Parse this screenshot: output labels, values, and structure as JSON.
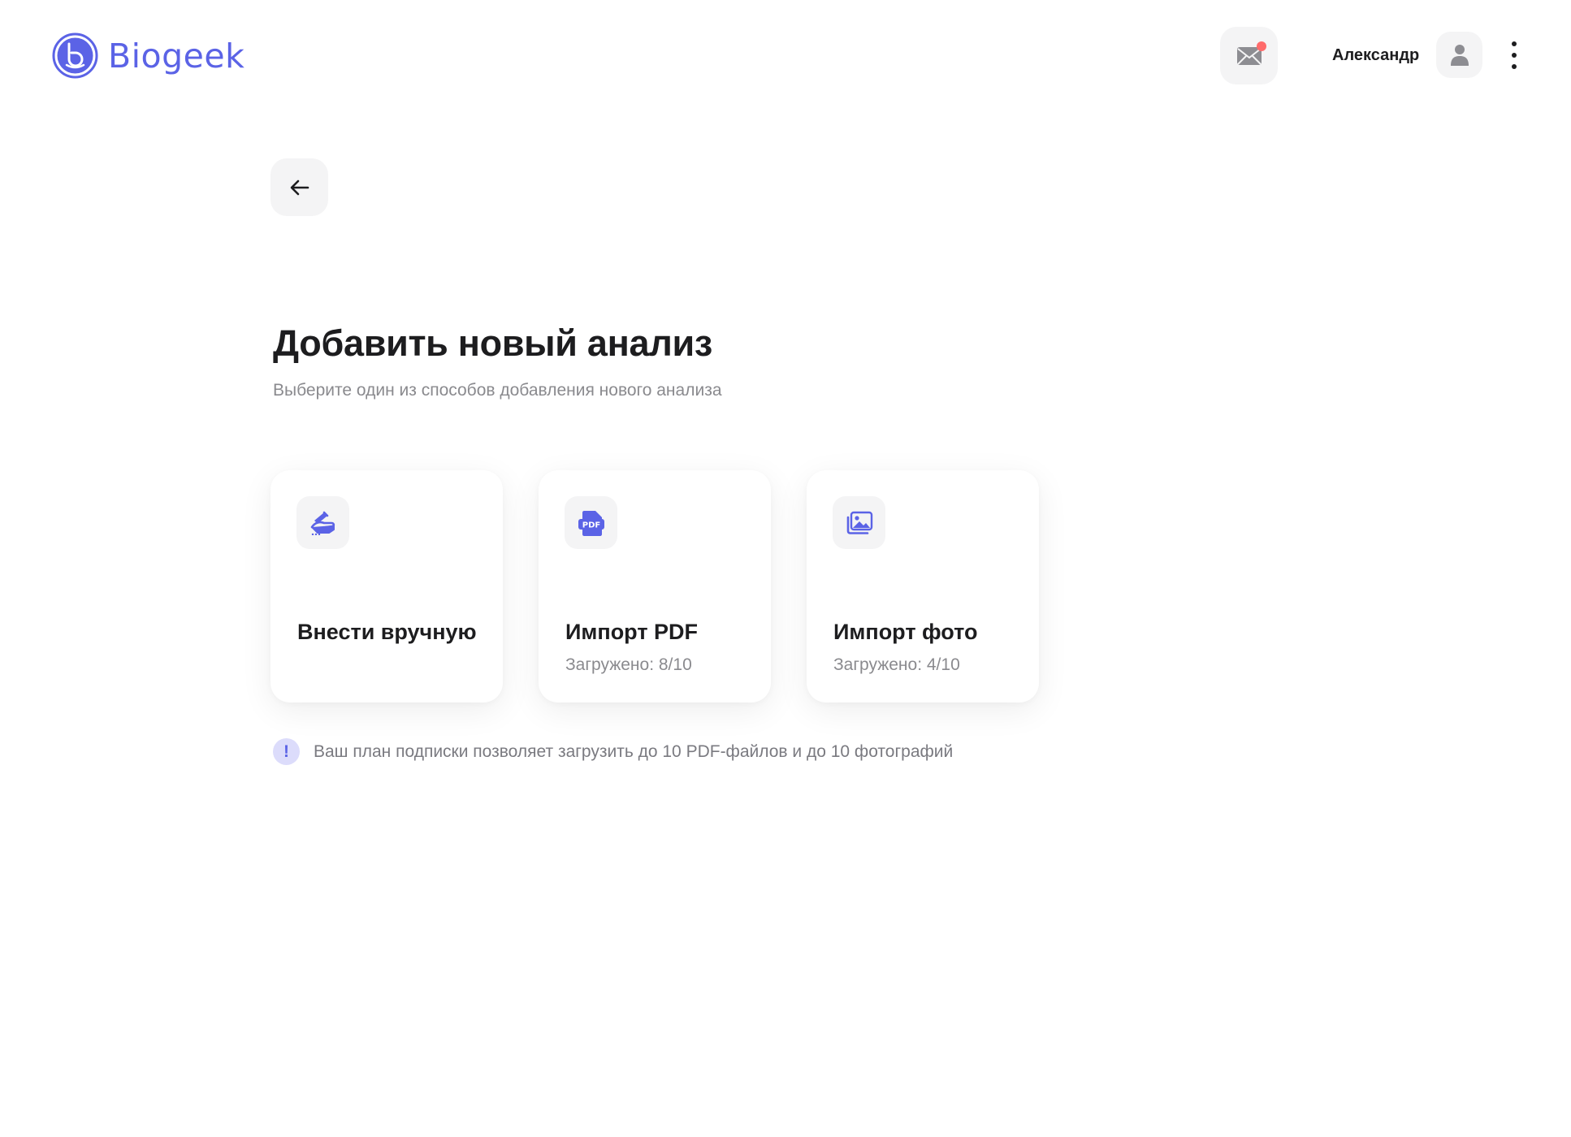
{
  "header": {
    "brand": "Biogeek",
    "user_name": "Александр",
    "has_unread": true
  },
  "main": {
    "title": "Добавить новый анализ",
    "subtitle": "Выберите один из способов добавления нового анализа",
    "cards": [
      {
        "icon": "hand-writing-icon",
        "title": "Внести вручную",
        "subtitle": ""
      },
      {
        "icon": "pdf-file-icon",
        "title": "Импорт PDF",
        "subtitle": "Загружено: 8/10"
      },
      {
        "icon": "photo-gallery-icon",
        "title": "Импорт фото",
        "subtitle": "Загружено: 4/10"
      }
    ],
    "notice": {
      "icon_label": "!",
      "text": "Ваш план подписки позволяет загрузить до 10 PDF-файлов и до 10 фотографий"
    }
  },
  "colors": {
    "accent": "#5b63e6",
    "notification_dot": "#ff6b6b",
    "muted_text": "#8a8a8e",
    "button_bg": "#f4f4f5"
  }
}
